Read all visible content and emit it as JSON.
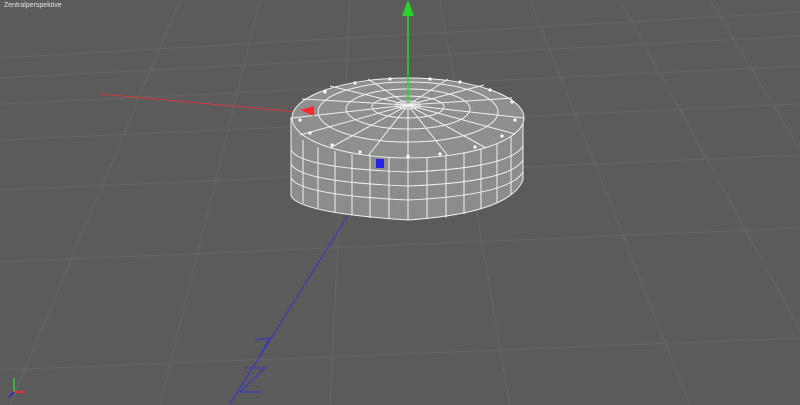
{
  "viewport": {
    "label": "Zentralperspektive"
  },
  "colors": {
    "background": "#5b5b5b",
    "grid": "#6a6a6a",
    "mesh_face": "#8f8f8f",
    "mesh_wire": "#f2f2f2",
    "axis_x": "#ff2a2a",
    "axis_y": "#2bd42b",
    "axis_z": "#2323e6"
  },
  "icons": {
    "world_axis": "axis-triad-icon",
    "move_x": "arrow-x-icon",
    "move_y": "arrow-y-icon",
    "move_z": "arrow-z-icon"
  }
}
